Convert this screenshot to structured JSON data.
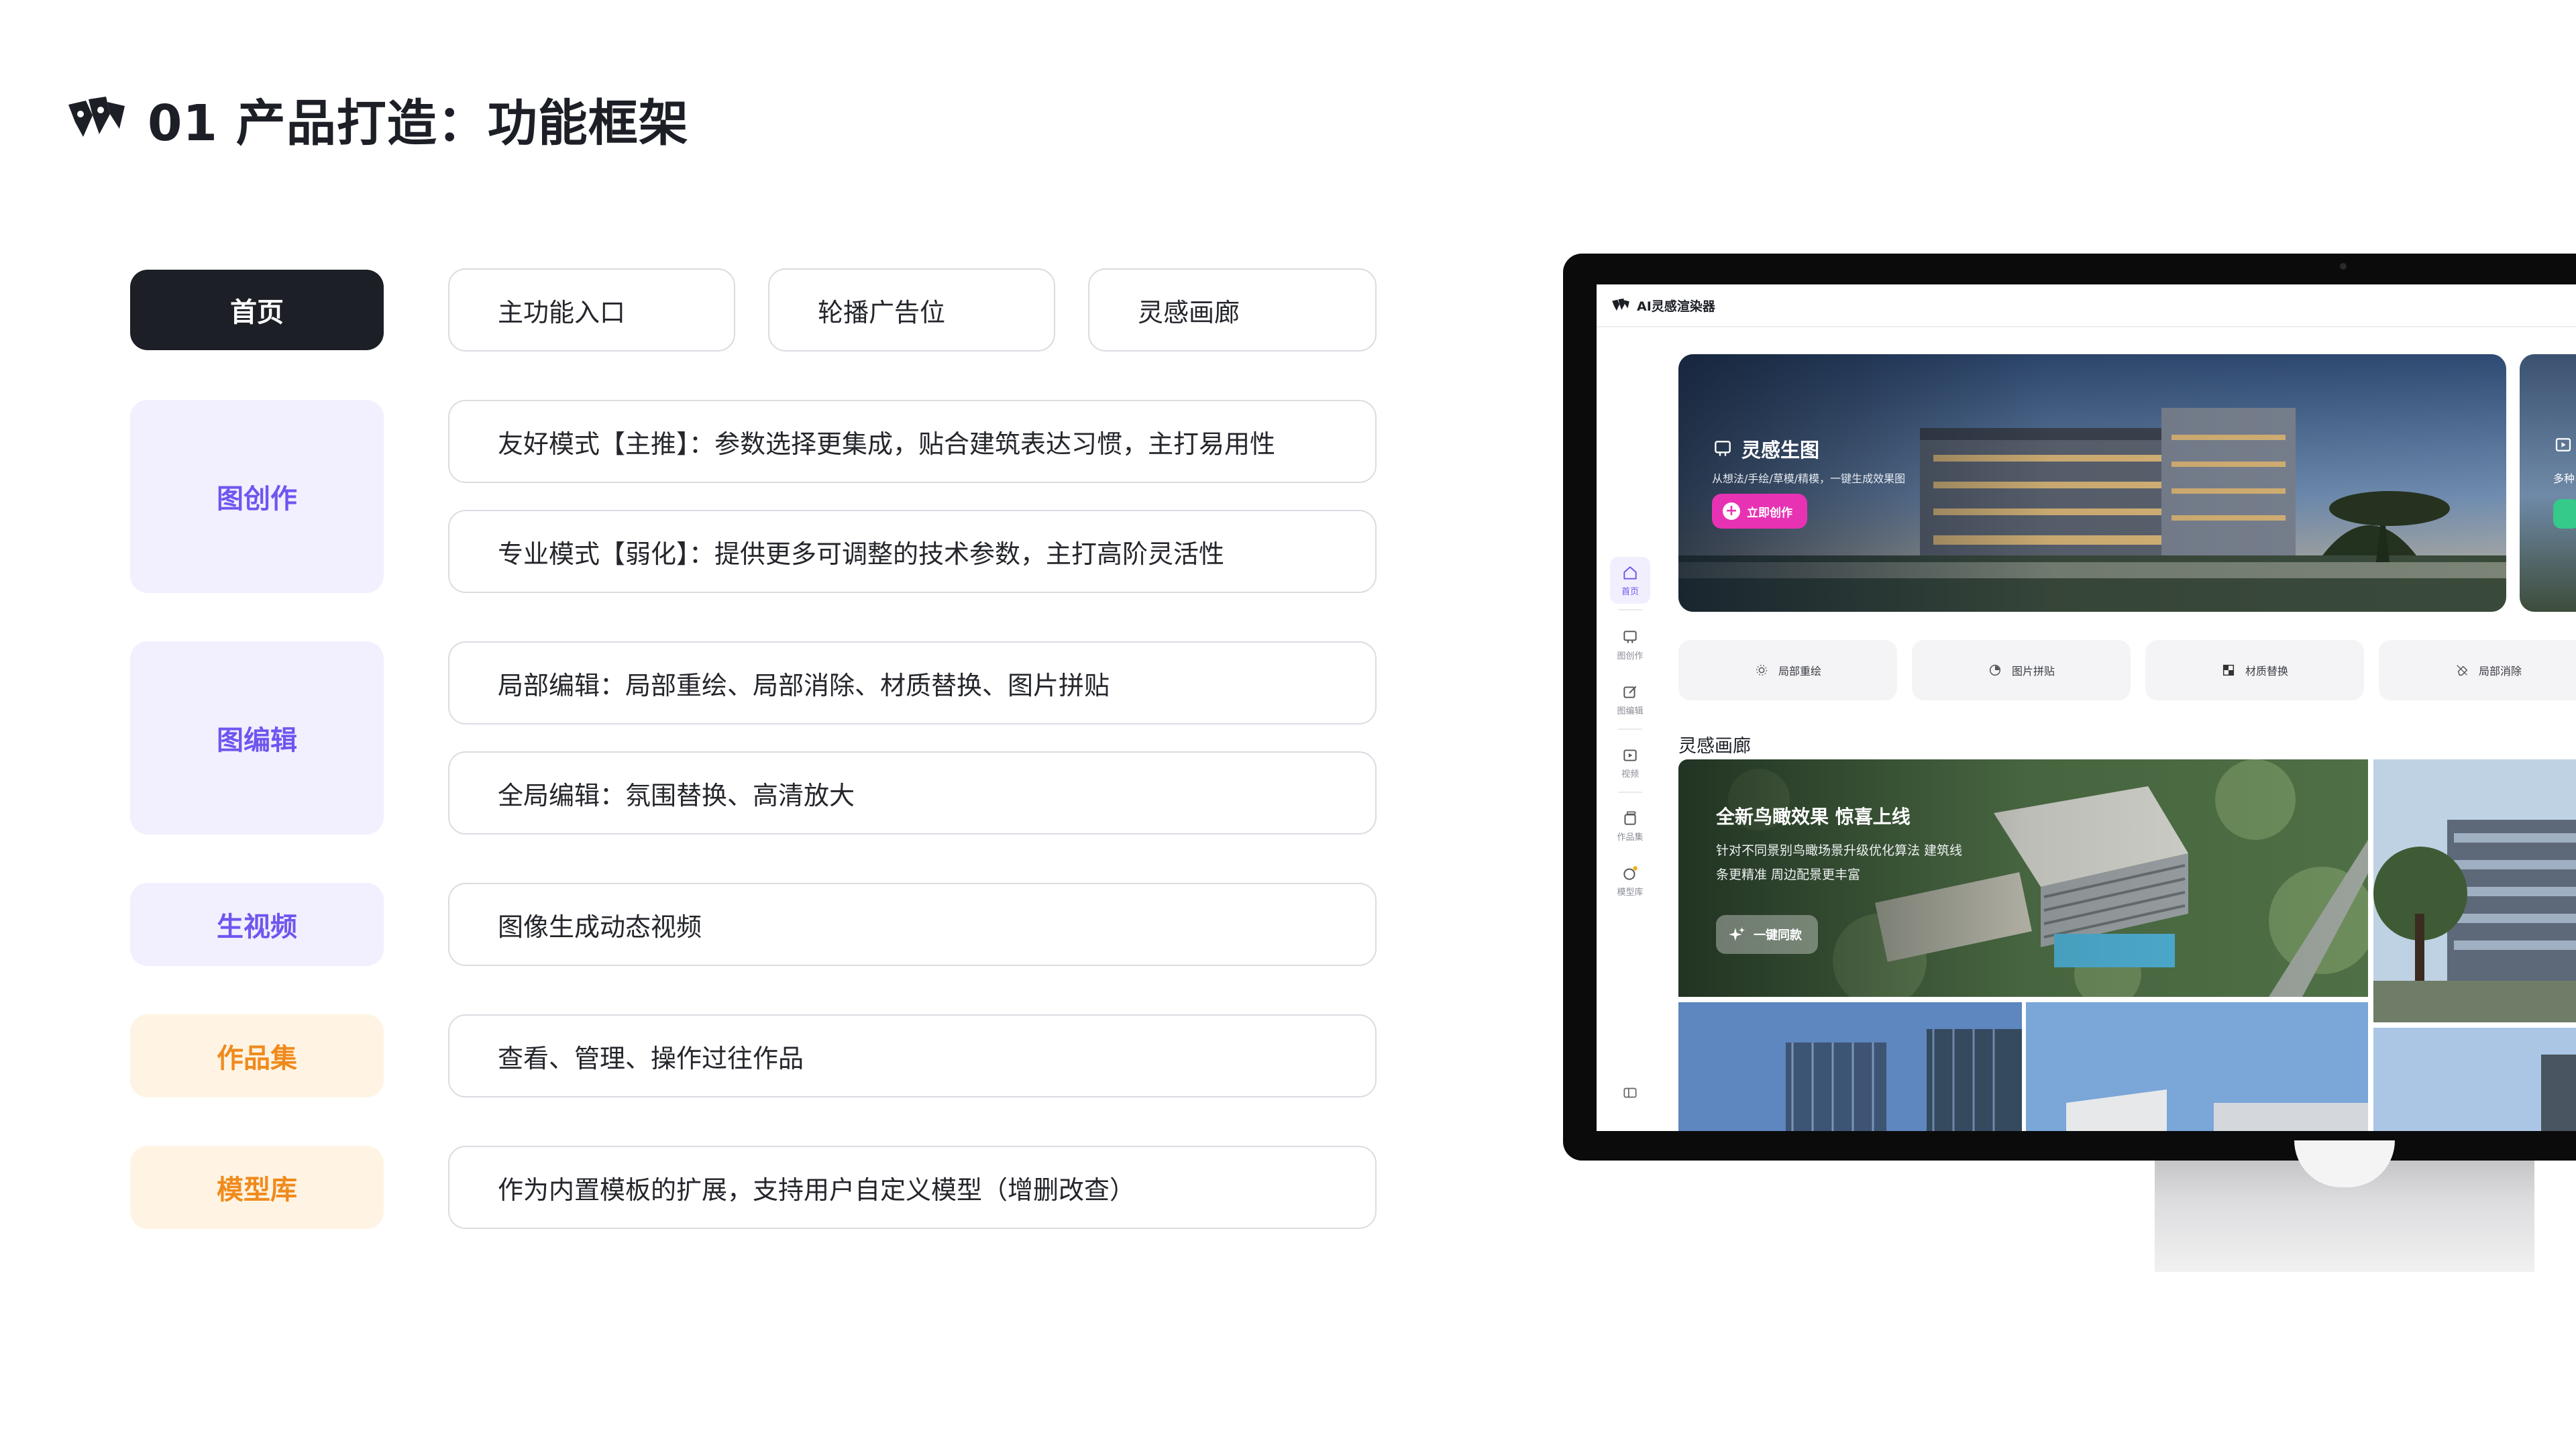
{
  "page": {
    "title": "01 产品打造：功能框架"
  },
  "framework": {
    "rows": [
      {
        "category": "首页",
        "features": [
          "主功能入口",
          "轮播广告位",
          "灵感画廊"
        ]
      },
      {
        "category": "图创作",
        "features": [
          "友好模式【主推】：参数选择更集成，贴合建筑表达习惯，主打易用性",
          "专业模式【弱化】：提供更多可调整的技术参数，主打高阶灵活性"
        ]
      },
      {
        "category": "图编辑",
        "features": [
          "局部编辑：局部重绘、局部消除、材质替换、图片拼贴",
          "全局编辑：氛围替换、高清放大"
        ]
      },
      {
        "category": "生视频",
        "features": [
          "图像生成动态视频"
        ]
      },
      {
        "category": "作品集",
        "features": [
          "查看、管理、操作过往作品"
        ]
      },
      {
        "category": "模型库",
        "features": [
          "作为内置模板的扩展，支持用户自定义模型（增删改查）"
        ]
      }
    ],
    "colors": {
      "dark": "#1c1f26",
      "purple": "#6e56f0",
      "purple_bg": "#f2effe",
      "orange": "#f08a1c",
      "orange_bg": "#fff4e3"
    }
  },
  "app": {
    "name": "AI灵感渲染器",
    "sidebar": [
      {
        "label": "首页",
        "icon": "home-icon",
        "active": true
      },
      {
        "label": "图创作",
        "icon": "image-create-icon"
      },
      {
        "label": "图编辑",
        "icon": "edit-icon"
      },
      {
        "label": "视频",
        "icon": "video-icon"
      },
      {
        "label": "作品集",
        "icon": "portfolio-icon"
      },
      {
        "label": "模型库",
        "icon": "model-icon"
      }
    ],
    "hero": {
      "title": "灵感生图",
      "subtitle": "从想法/手绘/草模/精模，一键生成效果图",
      "button": "立即创作",
      "peek_title": "多种"
    },
    "tools": [
      {
        "label": "局部重绘",
        "icon": "repaint-icon"
      },
      {
        "label": "图片拼贴",
        "icon": "collage-icon"
      },
      {
        "label": "材质替换",
        "icon": "material-icon"
      },
      {
        "label": "局部消除",
        "icon": "erase-icon"
      }
    ],
    "gallery": {
      "title": "灵感画廊",
      "feature_title": "全新鸟瞰效果 惊喜上线",
      "feature_desc": "针对不同景别鸟瞰场景升级优化算法 建筑线条更精准 周边配景更丰富",
      "feature_button": "一键同款"
    },
    "accent": "#e832b4"
  }
}
